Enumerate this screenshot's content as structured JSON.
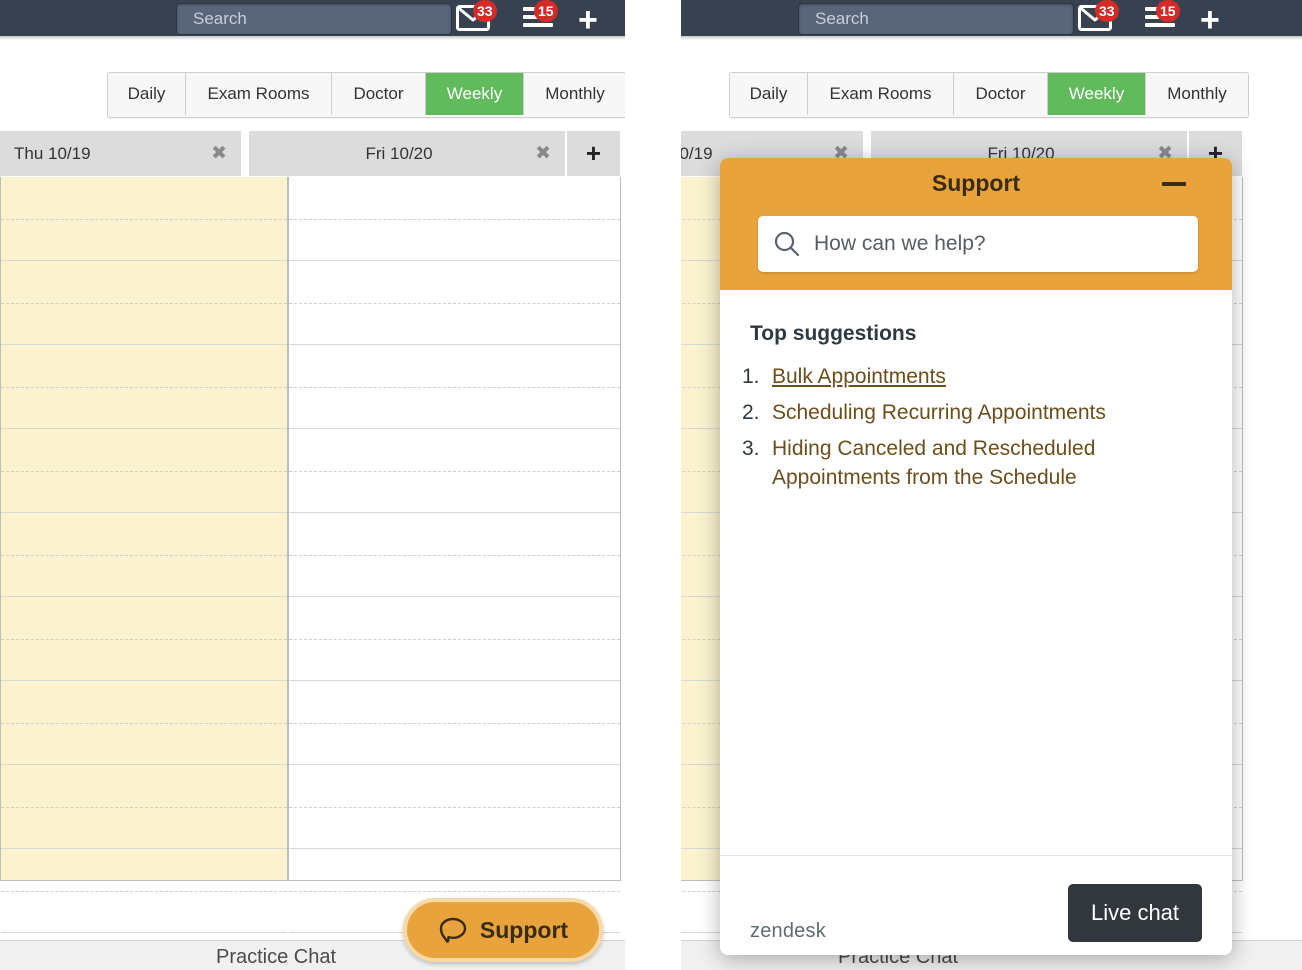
{
  "nav": {
    "search_placeholder": "Search",
    "mail_badge": "33",
    "menu_badge": "15",
    "add_label": "+"
  },
  "view_tabs": [
    {
      "label": "Daily",
      "active": false
    },
    {
      "label": "Exam Rooms",
      "active": false
    },
    {
      "label": "Doctor",
      "active": false
    },
    {
      "label": "Weekly",
      "active": true
    },
    {
      "label": "Monthly",
      "active": false
    }
  ],
  "day_columns": [
    {
      "label": "Thu 10/19",
      "close_label": "✖"
    },
    {
      "label": "Fri 10/20",
      "close_label": "✖"
    }
  ],
  "add_column_label": "➕",
  "bottom_bar": {
    "practice_chat": "Practice Chat"
  },
  "launcher": {
    "label": "Support",
    "icon": "chat-bubble-icon",
    "color": "#e8a33d"
  },
  "widget": {
    "title": "Support",
    "minimize_label": "—",
    "search_placeholder": "How can we help?",
    "suggestions_title": "Top suggestions",
    "suggestions": [
      {
        "number": "1.",
        "text": "Bulk Appointments",
        "underlined": true
      },
      {
        "number": "2.",
        "text": "Scheduling Recurring Appointments",
        "underlined": false
      },
      {
        "number": "3.",
        "text": "Hiding Canceled and Rescheduled Appointments from the Schedule",
        "underlined": false
      }
    ],
    "brand": "zendesk",
    "live_chat_label": "Live chat",
    "header_color": "#e8a33d",
    "link_color": "#6b4f1d",
    "live_chat_color": "#31373d"
  },
  "colors": {
    "topbar": "#37414f",
    "search_field": "#596579",
    "badge": "#d32b28",
    "active_tab": "#61bb5c",
    "day_header": "#dcdcdc",
    "busy_column": "#faf3ce"
  }
}
